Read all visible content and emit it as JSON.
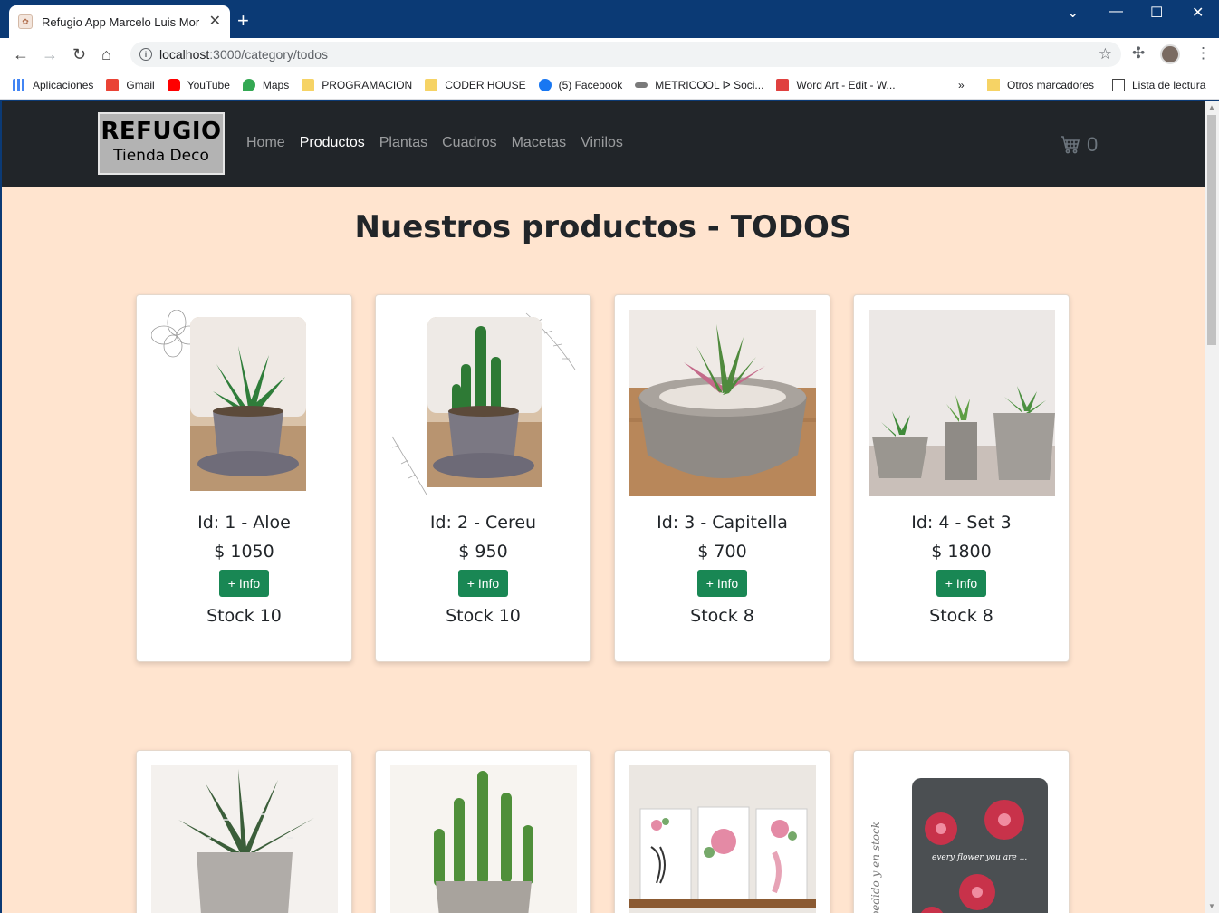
{
  "browser": {
    "tab_title": "Refugio App Marcelo Luis Moren",
    "tab_close": "✕",
    "new_tab": "+",
    "url_host": "localhost",
    "url_path": ":3000/category/todos",
    "bookmarks": [
      {
        "label": "Aplicaciones",
        "icon": "apps-grid-icon",
        "color": "#4285f4"
      },
      {
        "label": "Gmail",
        "icon": "gmail-icon",
        "color": "#ea4335"
      },
      {
        "label": "YouTube",
        "icon": "youtube-icon",
        "color": "#ff0000"
      },
      {
        "label": "Maps",
        "icon": "maps-icon",
        "color": "#34a853"
      },
      {
        "label": "PROGRAMACION",
        "icon": "folder-icon",
        "color": "#f6d365"
      },
      {
        "label": "CODER HOUSE",
        "icon": "folder-icon",
        "color": "#f6d365"
      },
      {
        "label": "(5) Facebook",
        "icon": "facebook-icon",
        "color": "#1877f2"
      },
      {
        "label": "METRICOOL ᐅ Soci...",
        "icon": "metricool-icon",
        "color": "#7a7a7a"
      },
      {
        "label": "Word Art - Edit - W...",
        "icon": "wordart-icon",
        "color": "#e0413f"
      }
    ],
    "more_bookmarks": "»",
    "other_bookmarks": "Otros marcadores",
    "reading_list": "Lista de lectura"
  },
  "site": {
    "brand_title": "REFUGIO",
    "brand_sub": "Tienda Deco",
    "nav": [
      "Home",
      "Productos",
      "Plantas",
      "Cuadros",
      "Macetas",
      "Vinilos"
    ],
    "active_nav": "Productos",
    "cart_count": "0",
    "page_title": "Nuestros productos - TODOS",
    "info_label": "+ Info"
  },
  "products": [
    {
      "name": "Id: 1 - Aloe",
      "price": "$ 1050",
      "stock": "Stock 10"
    },
    {
      "name": "Id: 2 - Cereu",
      "price": "$ 950",
      "stock": "Stock 10"
    },
    {
      "name": "Id: 3 - Capitella",
      "price": "$ 700",
      "stock": "Stock 8"
    },
    {
      "name": "Id: 4 - Set 3",
      "price": "$ 1800",
      "stock": "Stock 8"
    }
  ],
  "artwork_text": {
    "vinyl_side": "y a pedido y en stock",
    "vinyl_card": "every flower you are ..."
  },
  "colors": {
    "page_bg": "#ffe4cf",
    "navbar": "#212529",
    "button": "#198754",
    "chrome_frame": "#0b3a75"
  }
}
